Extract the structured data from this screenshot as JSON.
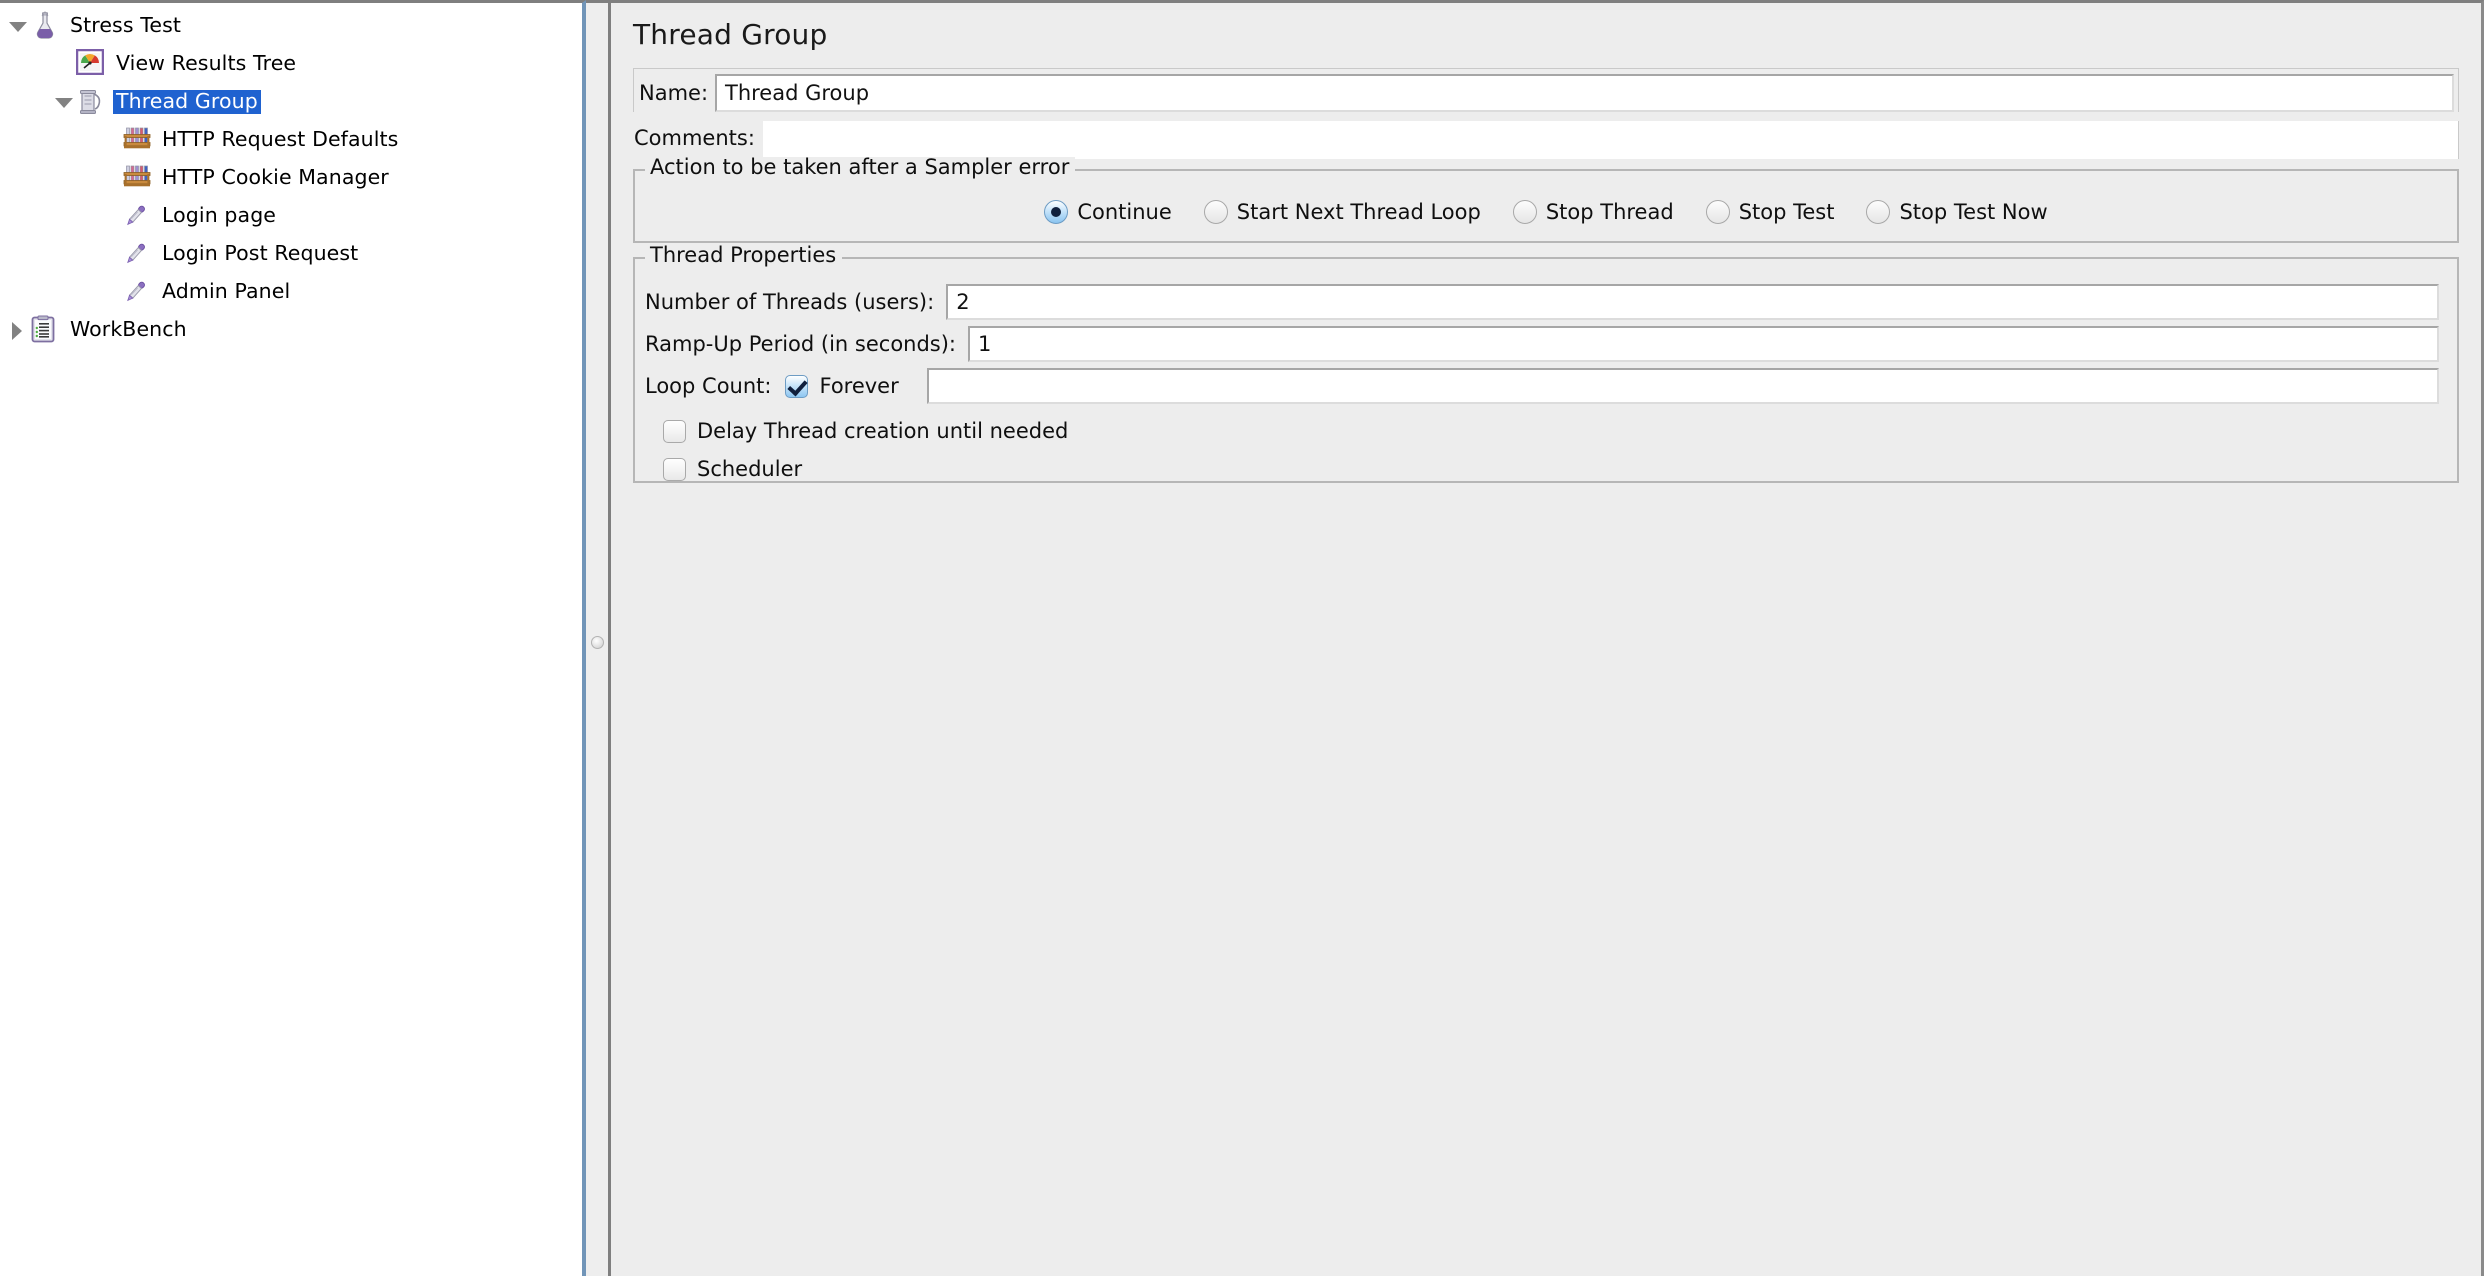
{
  "tree": {
    "nodes": [
      {
        "label": "Stress Test",
        "icon": "flask-icon",
        "level": 0,
        "twisty": "open",
        "selected": false
      },
      {
        "label": "View Results Tree",
        "icon": "results-tree-icon",
        "level": 1,
        "twisty": "none",
        "selected": false
      },
      {
        "label": "Thread Group",
        "icon": "thread-group-icon",
        "level": 1,
        "twisty": "open",
        "selected": true
      },
      {
        "label": "HTTP Request Defaults",
        "icon": "test-tube-rack-icon",
        "level": 2,
        "twisty": "none",
        "selected": false
      },
      {
        "label": "HTTP Cookie Manager",
        "icon": "test-tube-rack-icon",
        "level": 2,
        "twisty": "none",
        "selected": false
      },
      {
        "label": "Login page",
        "icon": "pipette-icon",
        "level": 2,
        "twisty": "none",
        "selected": false
      },
      {
        "label": "Login Post Request",
        "icon": "pipette-icon",
        "level": 2,
        "twisty": "none",
        "selected": false
      },
      {
        "label": "Admin Panel",
        "icon": "pipette-icon",
        "level": 2,
        "twisty": "none",
        "selected": false
      },
      {
        "label": "WorkBench",
        "icon": "clipboard-icon",
        "level": 0,
        "twisty": "closed",
        "selected": false
      }
    ],
    "selection_color": "#1f62d0"
  },
  "detail": {
    "title": "Thread Group",
    "name_label": "Name:",
    "name_value": "Thread Group",
    "comments_label": "Comments:",
    "comments_value": "",
    "sampler_error": {
      "group_title": "Action to be taken after a Sampler error",
      "options": [
        {
          "label": "Continue",
          "checked": true
        },
        {
          "label": "Start Next Thread Loop",
          "checked": false
        },
        {
          "label": "Stop Thread",
          "checked": false
        },
        {
          "label": "Stop Test",
          "checked": false
        },
        {
          "label": "Stop Test Now",
          "checked": false
        }
      ]
    },
    "thread_properties": {
      "group_title": "Thread Properties",
      "threads_label": "Number of Threads (users):",
      "threads_value": "2",
      "ramp_label": "Ramp-Up Period (in seconds):",
      "ramp_value": "1",
      "loop_label": "Loop Count:",
      "forever_label": "Forever",
      "forever_checked": true,
      "loop_value": "",
      "delay_label": "Delay Thread creation until needed",
      "delay_checked": false,
      "scheduler_label": "Scheduler",
      "scheduler_checked": false
    }
  }
}
